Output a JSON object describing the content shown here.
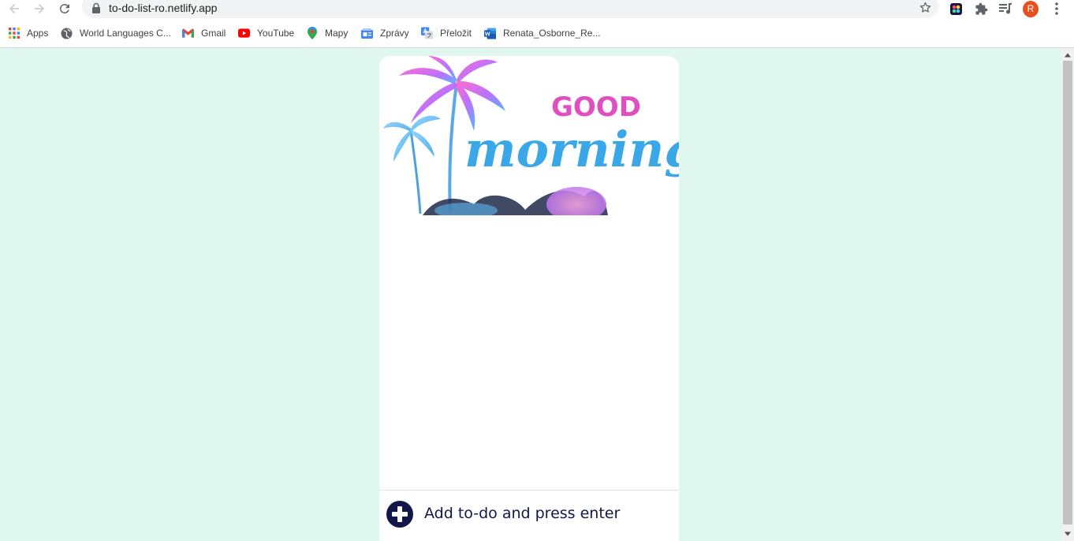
{
  "browser": {
    "url": "to-do-list-ro.netlify.app",
    "profile_initial": "R",
    "icons": [
      "back-icon",
      "forward-icon",
      "reload-icon",
      "lock-icon",
      "star-icon",
      "extension-icon",
      "puzzle-icon",
      "media-queue-icon",
      "kebab-menu-icon"
    ]
  },
  "bookmarks": [
    {
      "label": "Apps",
      "icon": "apps-grid-icon"
    },
    {
      "label": "World Languages C...",
      "icon": "globe-icon"
    },
    {
      "label": "Gmail",
      "icon": "gmail-icon"
    },
    {
      "label": "YouTube",
      "icon": "youtube-icon"
    },
    {
      "label": "Mapy",
      "icon": "maps-pin-icon"
    },
    {
      "label": "Zprávy",
      "icon": "news-icon"
    },
    {
      "label": "Přeložit",
      "icon": "translate-icon"
    },
    {
      "label": "Renata_Osborne_Re...",
      "icon": "word-doc-icon"
    }
  ],
  "app": {
    "hero_image_text_top": "GOOD",
    "hero_image_text_main": "morning",
    "add_placeholder": "Add to-do and press enter"
  },
  "colors": {
    "page_background": "#dff7ef",
    "card_background": "#ffffff",
    "accent_navy": "#12174a",
    "hero_pink": "#e04fc0",
    "hero_blue": "#3aa8e8"
  }
}
